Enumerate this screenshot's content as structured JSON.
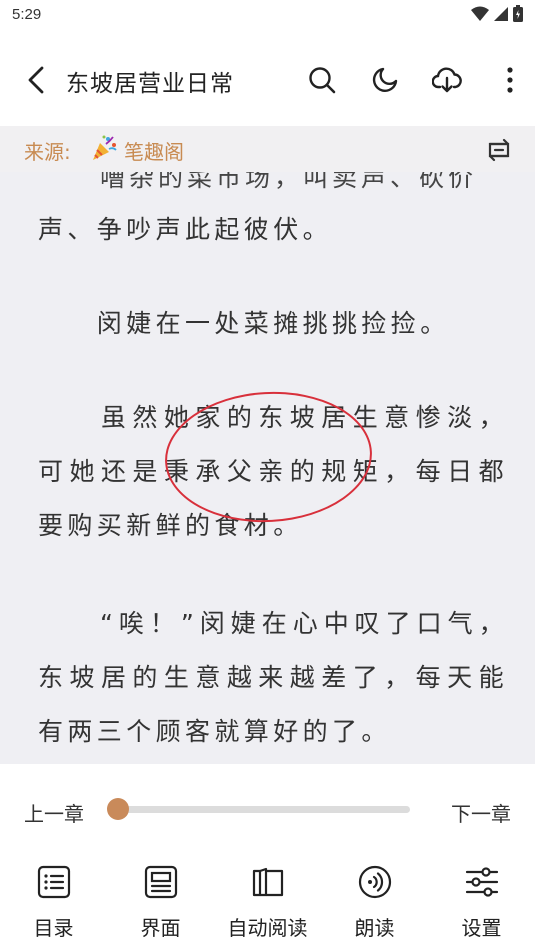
{
  "status_bar": {
    "time": "5:29"
  },
  "app_bar": {
    "title": "东坡居营业日常"
  },
  "source_bar": {
    "label": "来源:",
    "site": "笔趣阁"
  },
  "content": {
    "top_fragment": "嘈杂的菜市场，叫卖声、砍价",
    "paragraphs": [
      "声、争吵声此起彼伏。",
      "　　闵婕在一处菜摊挑挑捡捡。",
      "　　虽然她家的东坡居生意惨淡，可她还是秉承父亲的规矩，每日都要购买新鲜的食材。",
      "　　“唉！”闵婕在心中叹了口气，东坡居的生意越来越差了，每天能有两三个顾客就算好的了。"
    ]
  },
  "progress": {
    "prev_label": "上一章",
    "next_label": "下一章",
    "value": 0.0
  },
  "bottom_nav": [
    {
      "label": "目录",
      "icon": "catalog-icon"
    },
    {
      "label": "界面",
      "icon": "layout-icon"
    },
    {
      "label": "自动阅读",
      "icon": "book-icon"
    },
    {
      "label": "朗读",
      "icon": "read-aloud-icon"
    },
    {
      "label": "设置",
      "icon": "settings-sliders-icon"
    }
  ],
  "colors": {
    "accent": "#c98a5a",
    "annotation": "#d8303b",
    "reader_bg": "#efeff3",
    "source_text": "#c88b52"
  }
}
